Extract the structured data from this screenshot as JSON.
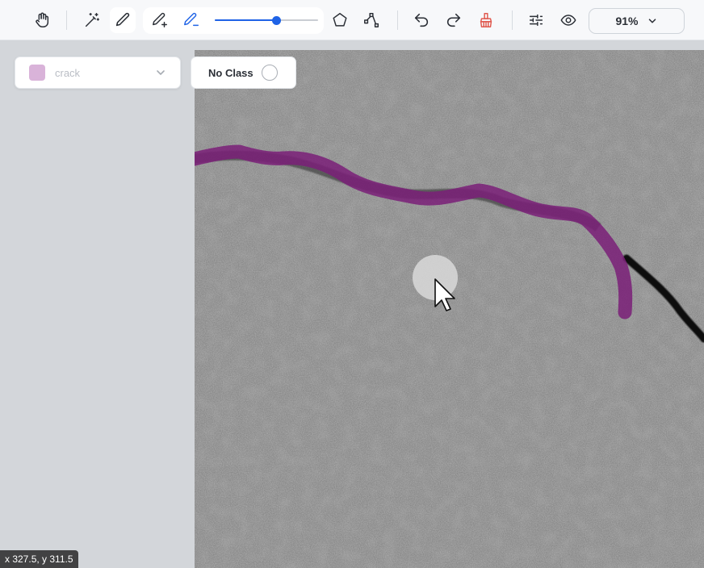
{
  "toolbar": {
    "tools": [
      {
        "name": "pan",
        "icon": "hand-icon"
      },
      {
        "name": "magic-wand",
        "icon": "magic-wand-icon"
      },
      {
        "name": "brush",
        "icon": "pencil-icon",
        "active": true
      },
      {
        "name": "brush-add",
        "icon": "pencil-plus-icon"
      },
      {
        "name": "brush-subtract",
        "icon": "pencil-minus-icon"
      },
      {
        "name": "polygon",
        "icon": "pentagon-icon"
      },
      {
        "name": "polyline",
        "icon": "polyline-icon"
      },
      {
        "name": "undo",
        "icon": "undo-icon"
      },
      {
        "name": "redo",
        "icon": "redo-icon"
      },
      {
        "name": "clear",
        "icon": "broom-icon"
      },
      {
        "name": "adjustments",
        "icon": "sliders-icon"
      },
      {
        "name": "visibility",
        "icon": "eye-icon"
      }
    ],
    "brush_size_fraction": 0.59,
    "zoom_label": "91%"
  },
  "class_selector": {
    "selected_label": "crack",
    "swatch_color": "#d9b3d9"
  },
  "no_class_button": {
    "label": "No Class"
  },
  "status": {
    "coords_text": "x 327.5, y 311.5"
  },
  "colors": {
    "annotation_stroke": "#7a1f78",
    "accent": "#1f63e6",
    "clear_icon": "#e05a4f"
  }
}
